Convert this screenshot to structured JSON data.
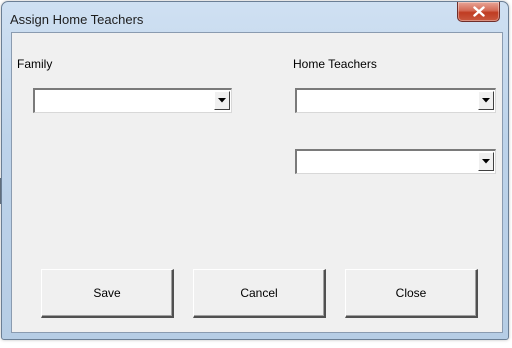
{
  "window": {
    "title": "Assign Home Teachers"
  },
  "family": {
    "label": "Family",
    "selected_value": ""
  },
  "home_teachers": {
    "label": "Home Teachers",
    "first_selected_value": "",
    "second_selected_value": ""
  },
  "buttons": {
    "save": "Save",
    "cancel": "Cancel",
    "close": "Close"
  },
  "icons": {
    "close": "close-icon",
    "dropdown": "chevron-down-icon"
  },
  "colors": {
    "dialog_background": "#f0f0f0",
    "titlebar": "#bdd3ea",
    "close_button": "#c9583f"
  }
}
